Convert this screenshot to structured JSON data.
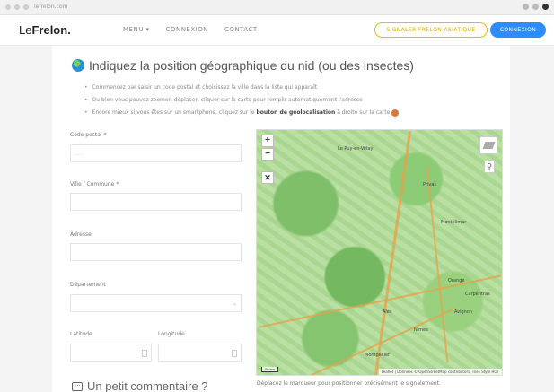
{
  "browser": {
    "url": "lefrelon.com"
  },
  "header": {
    "logo_prefix": "Le",
    "logo_main": "Frelon.",
    "nav": [
      "MENU ▾",
      "CONNEXION",
      "CONTACT"
    ],
    "report_button": "SIGNALER FRELON ASIATIQUE",
    "login_button": "CONNEXION",
    "accent": "#2d8cff",
    "report_color": "#f0b400"
  },
  "form": {
    "section_title": "Indiquez la position géographique du nid (ou des insectes)",
    "bullets": [
      "Commencez par saisir un code postal et choisissez la ville dans la liste qui apparaît",
      "Ou bien vous pouvez zoomer, déplacer, cliquer sur la carte pour remplir automatiquement l'adresse"
    ],
    "bullet3_prefix": "Encore mieux si vous êtes sur un smartphone, cliquez sur le",
    "bullet3_bold": "bouton de géolocalisation",
    "bullet3_suffix": "à droite sur la carte",
    "postal_label": "Code postal *",
    "postal_placeholder": ".....",
    "city_label": "Ville / Commune *",
    "address_label": "Adresse",
    "department_label": "Département",
    "latitude_label": "Latitude",
    "longitude_label": "Longitude"
  },
  "map": {
    "zoom_in": "+",
    "zoom_out": "−",
    "fullscreen": "✕",
    "pin": "⚲",
    "scale": "50 km",
    "attribution": "Leaflet | Données © OpenStreetMap contributors, Tiles Style HOT",
    "caption": "Déplacez le marqueur pour positionner précisément le signalement.",
    "cities": [
      "Le Puy-en-Velay",
      "Privas",
      "Montélimar",
      "Alès",
      "Avignon",
      "Nîmes",
      "Montpellier",
      "Carpentras",
      "Orange"
    ]
  },
  "comment": {
    "title": "Un petit commentaire ?"
  }
}
